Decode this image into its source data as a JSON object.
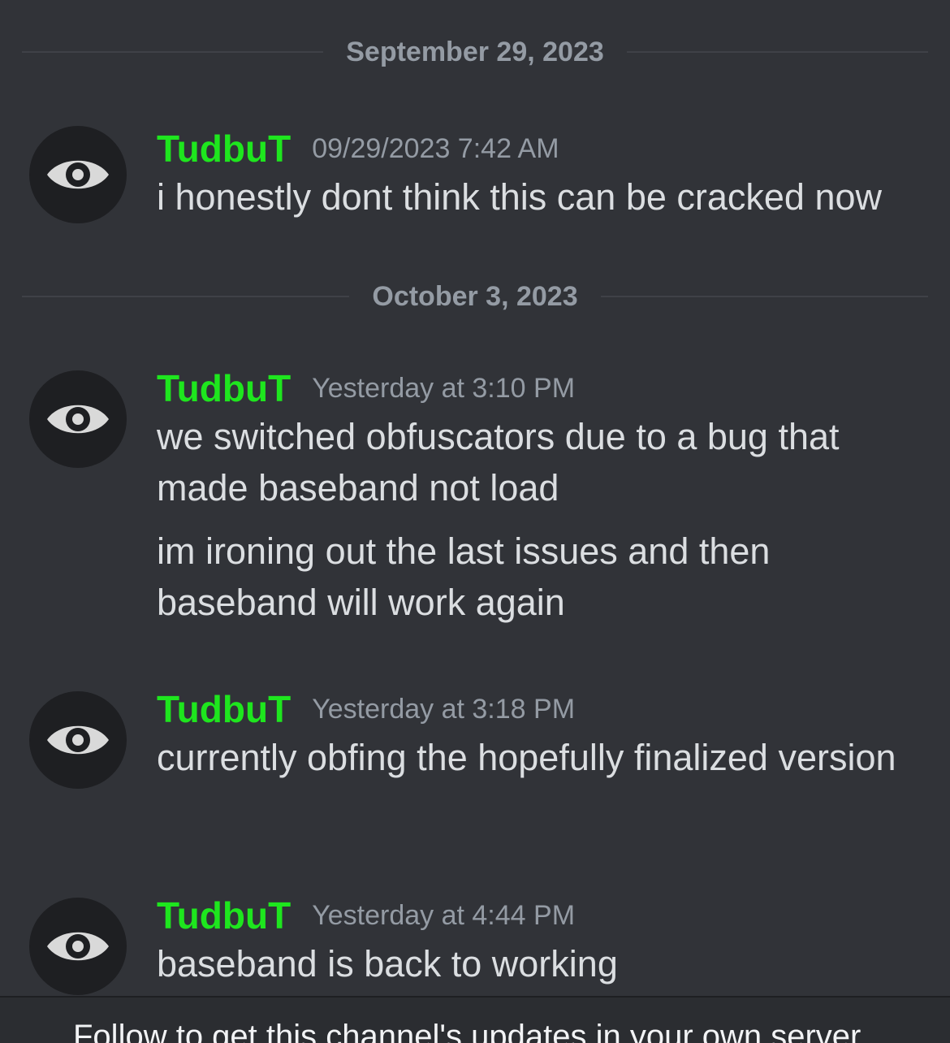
{
  "dividers": [
    {
      "date": "September 29, 2023"
    },
    {
      "date": "October 3, 2023"
    }
  ],
  "messages": [
    {
      "username": "TudbuT",
      "timestamp": "09/29/2023 7:42 AM",
      "lines": [
        "i honestly dont think this can be cracked now"
      ]
    },
    {
      "username": "TudbuT",
      "timestamp": "Yesterday at 3:10 PM",
      "lines": [
        "we switched obfuscators due to a bug that made baseband not load",
        "im ironing out the last issues and then baseband will work again"
      ]
    },
    {
      "username": "TudbuT",
      "timestamp": "Yesterday at 3:18 PM",
      "lines": [
        "currently obfing the hopefully finalized version"
      ]
    },
    {
      "username": "TudbuT",
      "timestamp": "Yesterday at 4:44 PM",
      "lines": [
        "baseband is back to working"
      ]
    }
  ],
  "banner": {
    "text": "Follow to get this channel's updates in your own server"
  },
  "colors": {
    "background": "#313338",
    "username": "#1ee61e",
    "timestamp": "#949ba4",
    "message_text": "#dbdee1",
    "avatar_bg": "#1e1f22"
  },
  "icons": {
    "avatar": "eye-icon"
  }
}
